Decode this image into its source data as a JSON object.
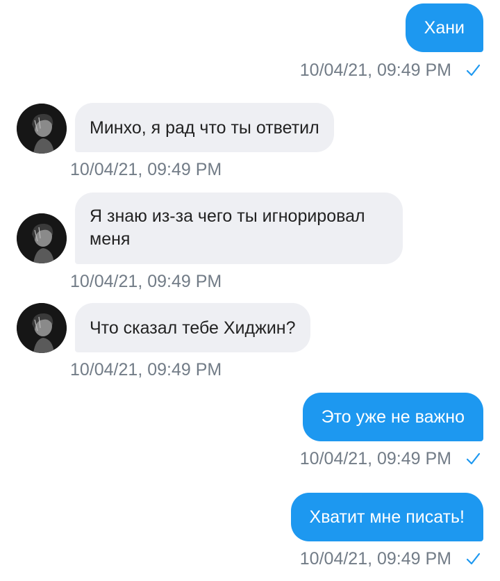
{
  "messages": [
    {
      "direction": "out",
      "text": "Хани",
      "time": "10/04/21, 09:49 PM",
      "status_icon": "check-icon"
    },
    {
      "direction": "in",
      "text": "Минхо, я рад что ты ответил",
      "time": "10/04/21, 09:49 PM",
      "avatar_icon": "avatar"
    },
    {
      "direction": "in",
      "text": "Я знаю из-за чего ты игнорировал меня",
      "time": "10/04/21, 09:49 PM",
      "avatar_icon": "avatar"
    },
    {
      "direction": "in",
      "text": "Что сказал тебе Хиджин?",
      "time": "10/04/21, 09:49 PM",
      "avatar_icon": "avatar"
    },
    {
      "direction": "out",
      "text": "Это уже не важно",
      "time": "10/04/21, 09:49 PM",
      "status_icon": "check-icon"
    },
    {
      "direction": "out",
      "text": "Хватит мне писать!",
      "time": "10/04/21, 09:49 PM",
      "status_icon": "check-icon"
    }
  ],
  "colors": {
    "outgoing_bubble": "#1d98f0",
    "incoming_bubble": "#eeeff3",
    "timestamp": "#727c87",
    "check": "#1d98f0"
  }
}
